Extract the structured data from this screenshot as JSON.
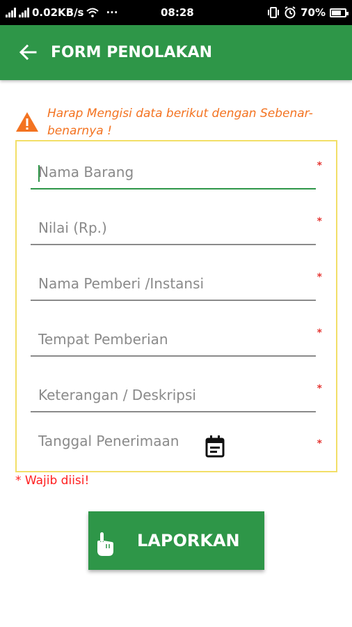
{
  "status_bar": {
    "network_speed": "0.02KB/s",
    "dots": "···",
    "time": "08:28",
    "battery": "70%",
    "battery_level": 0.7
  },
  "app_bar": {
    "title": "FORM PENOLAKAN"
  },
  "warning": {
    "text": "Harap Mengisi data berikut dengan Sebenar-benarnya !"
  },
  "form": {
    "required_mark": "*",
    "fields": [
      {
        "placeholder": "Nama Barang",
        "focused": true
      },
      {
        "placeholder": "Nilai (Rp.)",
        "focused": false
      },
      {
        "placeholder": "Nama Pemberi /Instansi",
        "focused": false
      },
      {
        "placeholder": "Tempat Pemberian",
        "focused": false
      },
      {
        "placeholder": "Keterangan / Deskripsi",
        "focused": false
      },
      {
        "placeholder": "Tanggal Penerimaan",
        "focused": false
      }
    ]
  },
  "required_note": "* Wajib diisi!",
  "submit_button": {
    "label": "LAPORKAN"
  },
  "colors": {
    "primary": "#2e9648",
    "warning": "#f37321",
    "required": "#e53935",
    "form_border": "#f2df67"
  }
}
